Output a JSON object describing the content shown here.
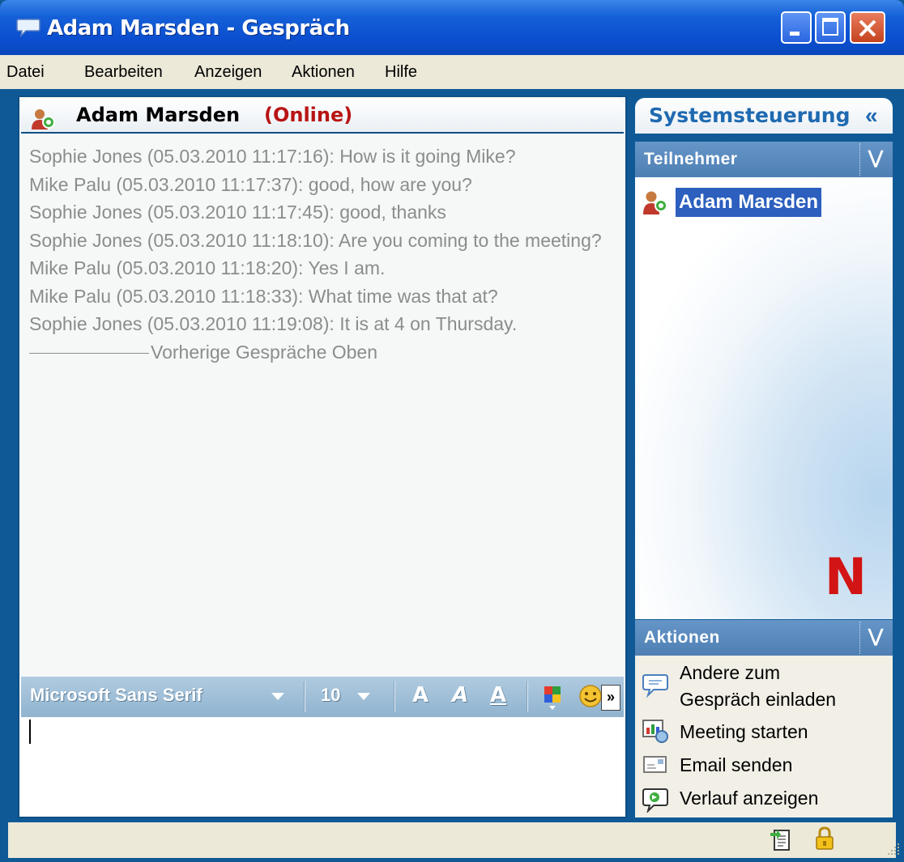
{
  "window": {
    "title": "Adam Marsden - Gespräch",
    "buttons": [
      "minimize-icon",
      "maximize-icon",
      "close-icon"
    ]
  },
  "menubar": {
    "items": [
      "Datei",
      "Bearbeiten",
      "Anzeigen",
      "Aktionen",
      "Hilfe"
    ]
  },
  "conversation": {
    "contact_name": "Adam Marsden",
    "contact_status": "(Online)",
    "messages": [
      "Sophie Jones  (05.03.2010 11:17:16): How is it going Mike?",
      "Mike Palu  (05.03.2010 11:17:37): good, how are you?",
      "Sophie Jones  (05.03.2010 11:17:45): good, thanks",
      "Sophie Jones  (05.03.2010 11:18:10): Are you coming to the meeting?",
      "Mike Palu  (05.03.2010 11:18:20): Yes I am.",
      "Mike Palu  (05.03.2010 11:18:33): What time was that at?",
      "Sophie Jones  (05.03.2010 11:19:08): It is at 4 on Thursday."
    ],
    "history_divider": "Vorherige Gespräche Oben"
  },
  "format_toolbar": {
    "font": "Microsoft Sans Serif",
    "size": "10",
    "bold": "A",
    "italic": "A",
    "underline": "A",
    "more": "»"
  },
  "sidebar": {
    "title": "Systemsteuerung",
    "collapse": "«",
    "participants": {
      "title": "Teilnehmer",
      "items": [
        "Adam Marsden"
      ]
    },
    "logo": "N",
    "actions": {
      "title": "Aktionen",
      "items": [
        {
          "line1": "Andere zum",
          "line2": "Gespräch einladen",
          "icon": "invite-icon"
        },
        {
          "line1": "Meeting starten",
          "icon": "meeting-icon"
        },
        {
          "line1": "Email senden",
          "icon": "email-icon"
        },
        {
          "line1": "Verlauf anzeigen",
          "icon": "history-icon"
        }
      ]
    }
  },
  "colors": {
    "frame": "#0f5a96",
    "titlebar": "#0b4fd0",
    "status_online": "#b81414",
    "accent": "#1f6ab1",
    "selection": "#2c5fbe"
  }
}
